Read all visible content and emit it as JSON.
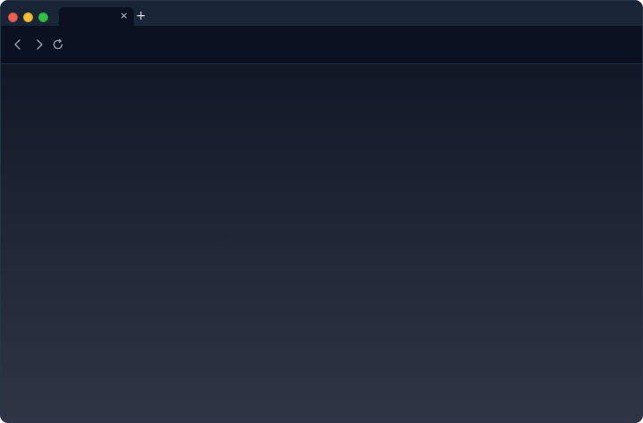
{
  "window": {
    "traffic_lights": [
      {
        "name": "close",
        "color": "#ee5f58"
      },
      {
        "name": "minimize",
        "color": "#f5be32"
      },
      {
        "name": "maximize",
        "color": "#35c043"
      }
    ]
  },
  "tabs": [
    {
      "title": "",
      "active": true,
      "close_glyph": "×"
    }
  ],
  "tabstrip": {
    "new_tab_glyph": "+"
  },
  "toolbar": {
    "back_icon": "chevron-left-icon",
    "forward_icon": "chevron-right-icon",
    "reload_icon": "reload-icon"
  },
  "theme": {
    "tabstrip_bg": "#172536",
    "toolbar_bg": "#0b1120",
    "content_gradient_top": "#0c1220",
    "content_gradient_bottom": "#2f3545"
  }
}
